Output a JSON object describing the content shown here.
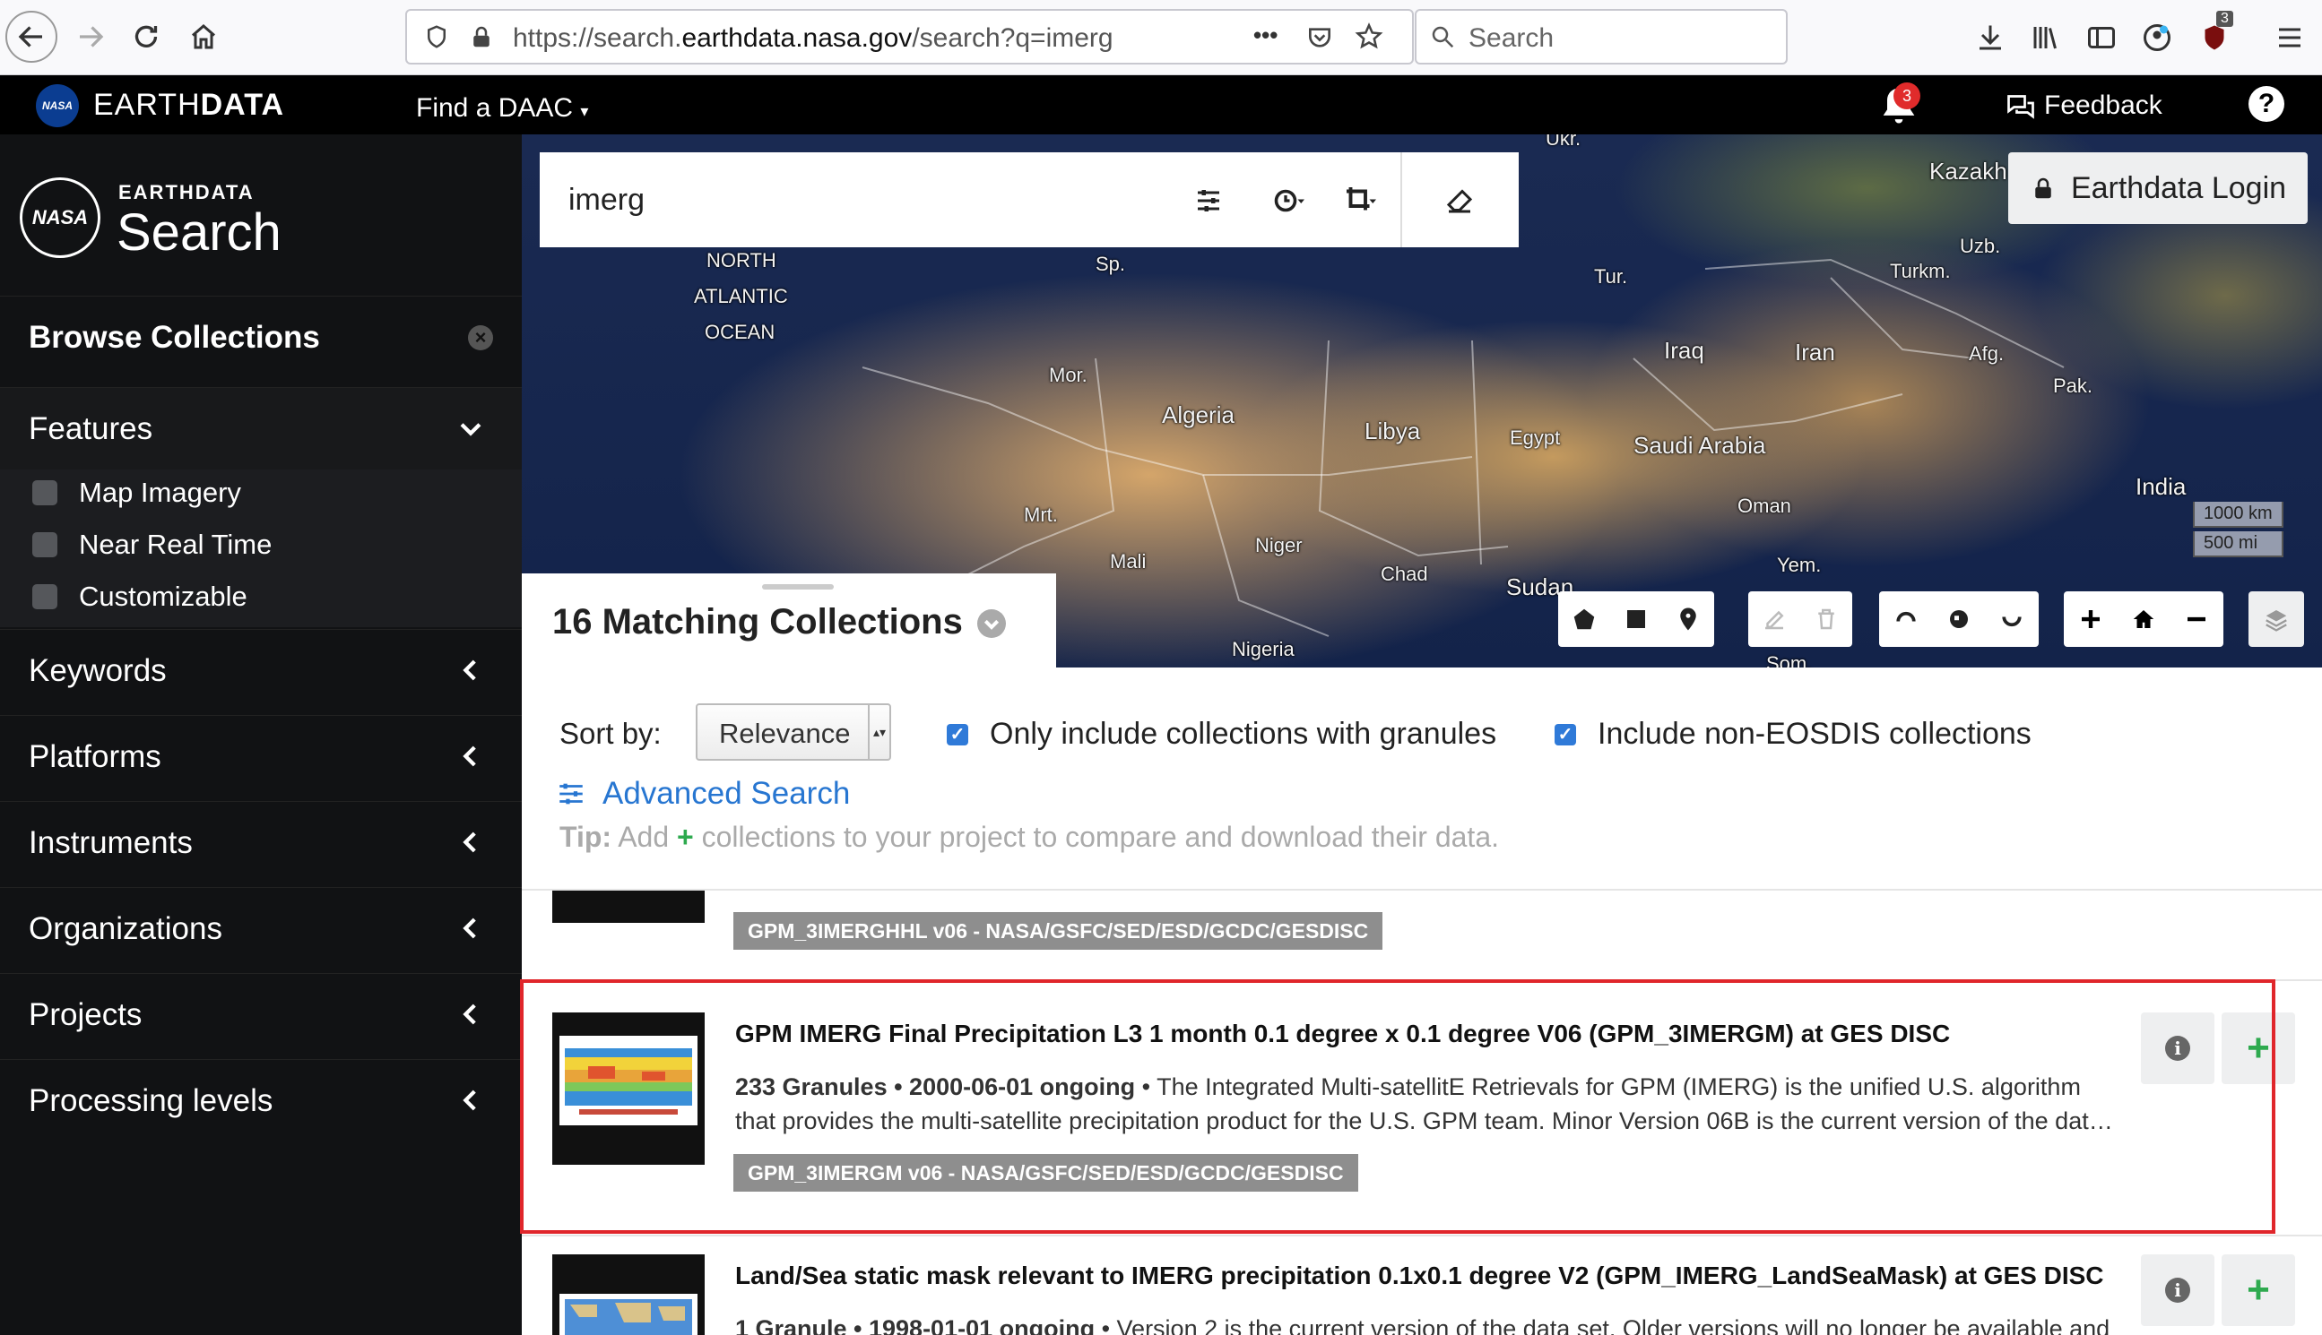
{
  "browser": {
    "url_prefix": "https://search.",
    "url_domain": "earthdata.nasa.gov",
    "url_path": "/search?q=imerg",
    "search_placeholder": "Search",
    "more_dots": "•••"
  },
  "header": {
    "brand_light": "EARTH",
    "brand_bold": "DATA",
    "find_daac": "Find a DAAC",
    "notification_count": "3",
    "feedback": "Feedback",
    "help": "?",
    "nasa_mark": "NASA"
  },
  "sidebar": {
    "small_title": "EARTHDATA",
    "big_title": "Search",
    "browse": "Browse Collections",
    "features": "Features",
    "feature_items": [
      "Map Imagery",
      "Near Real Time",
      "Customizable"
    ],
    "facets": [
      "Keywords",
      "Platforms",
      "Instruments",
      "Organizations",
      "Projects",
      "Processing levels"
    ]
  },
  "search": {
    "query": "imerg",
    "login": "Earthdata Login"
  },
  "map": {
    "labels": [
      "Ukr.",
      "Kazakh",
      "Sp.",
      "NORTH",
      "ATLANTIC",
      "OCEAN",
      "Tur.",
      "Turkm.",
      "Uzb.",
      "Afg.",
      "Iraq",
      "Iran",
      "Mor.",
      "Algeria",
      "Libya",
      "Egypt",
      "Saudi Arabia",
      "Pak.",
      "India",
      "Mrt.",
      "Niger",
      "Mali",
      "Chad",
      "Oman",
      "Sudan",
      "Yem.",
      "Nigeria",
      "Som."
    ],
    "scale_km": "1000 km",
    "scale_mi": "500 mi"
  },
  "results": {
    "title": "16 Matching Collections",
    "sort_label": "Sort by:",
    "sort_value": "Relevance",
    "check_granules": "Only include collections with granules",
    "check_noneosdis": "Include non-EOSDIS collections",
    "advanced_search": "Advanced Search",
    "tip_label": "Tip:",
    "tip_add": "Add",
    "tip_rest": "collections to your project to compare and download their data.",
    "collections": [
      {
        "tag": "GPM_3IMERGHHL v06 - NASA/GSFC/SED/ESD/GCDC/GESDISC"
      },
      {
        "title": "GPM IMERG Final Precipitation L3 1 month 0.1 degree x 0.1 degree V06 (GPM_3IMERGM) at GES DISC",
        "meta": "233 Granules • 2000-06-01 ongoing",
        "desc_line1": " • The Integrated Multi-satellitE Retrievals for GPM (IMERG) is the unified U.S. algorithm",
        "desc_line2": "that provides the multi-satellite precipitation product for the U.S. GPM team. Minor Version 06B is the current version of the dat…",
        "tag": "GPM_3IMERGM v06 - NASA/GSFC/SED/ESD/GCDC/GESDISC"
      },
      {
        "title": "Land/Sea static mask relevant to IMERG precipitation 0.1x0.1 degree V2 (GPM_IMERG_LandSeaMask) at GES DISC",
        "meta": "1 Granule • 1998-01-01 ongoing",
        "desc_line1": " • Version 2 is the current version of the data set. Older versions will no longer be available and"
      }
    ]
  },
  "colors": {
    "accent_blue": "#2776d1",
    "add_green": "#2eaa4f",
    "highlight_red": "#e0262b",
    "sidebar_bg": "#111214"
  }
}
